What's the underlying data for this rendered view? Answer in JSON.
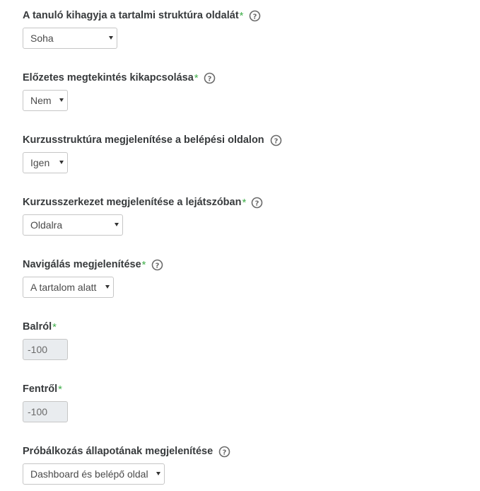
{
  "fields": [
    {
      "label": "A tanuló kihagyja a tartalmi struktúra oldalát",
      "required": "*",
      "value": "Soha"
    },
    {
      "label": "Előzetes megtekintés kikapcsolása",
      "required": "*",
      "value": "Nem"
    },
    {
      "label": "Kurzusstruktúra megjelenítése a belépési oldalon",
      "required": "",
      "value": "Igen"
    },
    {
      "label": "Kurzusszerkezet megjelenítése a lejátszóban",
      "required": "*",
      "value": "Oldalra"
    },
    {
      "label": "Navigálás megjelenítése",
      "required": "*",
      "value": "A tartalom alatt"
    },
    {
      "label": "Balról",
      "required": "*",
      "value": "-100"
    },
    {
      "label": "Fentről",
      "required": "*",
      "value": "-100"
    },
    {
      "label": "Próbálkozás állapotának megjelenítése",
      "required": "",
      "value": "Dashboard és belépő oldal"
    }
  ],
  "icons": {
    "help": "question-circle-icon"
  },
  "colors": {
    "required": "#3fae49",
    "label": "#373a3c"
  }
}
